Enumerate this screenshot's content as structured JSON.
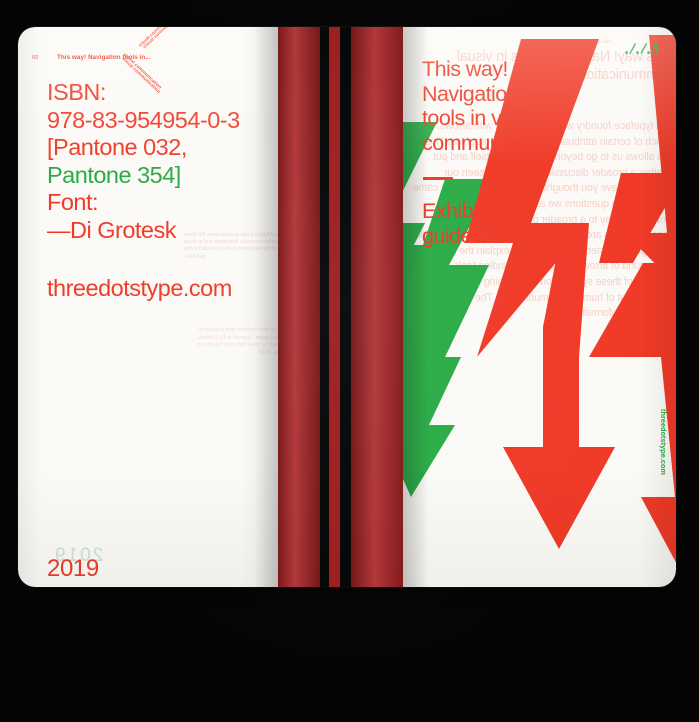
{
  "palette": {
    "red": "#f03a27",
    "green": "#2aab46",
    "spine_red": "#a81f22",
    "paper": "#fbfaf6",
    "backdrop": "#000000",
    "ink_black": "#101010"
  },
  "left_page": {
    "folio": "60",
    "running_title": "This way! Navigation tools in...",
    "chevron_microtype": "visual communication",
    "colophon_lines": [
      {
        "text": "ISBN:",
        "color": "red"
      },
      {
        "text": "978-83-954954-0-3",
        "color": "red"
      },
      {
        "text": "[Pantone 032,",
        "color": "red"
      },
      {
        "text": "Pantone 354]",
        "color": "green"
      },
      {
        "text": "Font:",
        "color": "red"
      },
      {
        "text": "—Di Grotesk",
        "color": "red"
      }
    ],
    "url": "threedotstype.com",
    "year": "2019",
    "ghost_year": "2019",
    "ghost_block": "The exhibition guide accompanies the show and gathers essays, interviews and a visual index of the navigation tools presented in the galleries.",
    "ghost_block2": "Printed in two Pantone spot colours on uncoated paper. Typeset in Di Grotesk. Published by three dots type foundry in Warsaw, 2019."
  },
  "right_page": {
    "headline_lines": [
      "This way!",
      "Navigation",
      "tools in visual",
      "communication"
    ],
    "subtitle_lines": [
      {
        "text": "Exhibition",
        "color": "red"
      },
      {
        "text": "guide",
        "color": "red"
      }
    ],
    "logo_mark": "threedots-logo-icon",
    "vertical_url": "threedotstype.com",
    "ghost_micro": "This way! Navigation tools in...",
    "ghost_headline": "This way! Navigation tools in visual communication",
    "ghost_body": "As a typeface foundry we are obsessed with arrows, as a branch of certain attributes of navigation graphics. This idea allows us to go beyond typography itself and put together a broader discussion. “Have you seen our signs?” or “Have you thought about where this form came from?” are the questions we asked ourselves when showing the way to a broader public. The answers to those questions are part of this exhibition about the world of navigation systems. The aim is to explain the historical background of arrows and other wayfinding tools, and the influence of these symbols on the shaping and development of human communication. The whole spectrum of information."
  },
  "graphics": {
    "arrows": [
      {
        "name": "green-zigzag-arrow",
        "color": "#2aab46"
      },
      {
        "name": "red-zigzag-arrow-center",
        "color": "#f03a27"
      },
      {
        "name": "red-zigzag-arrow-right",
        "color": "#f03a27"
      }
    ]
  },
  "spine": {
    "bands": [
      {
        "name": "spine-band-left",
        "color": "#a81f22"
      },
      {
        "name": "spine-gap-1",
        "color": "#060606"
      },
      {
        "name": "spine-band-center",
        "color": "#9d1d20"
      },
      {
        "name": "spine-gap-2",
        "color": "#050505"
      },
      {
        "name": "spine-band-right",
        "color": "#a81f22"
      }
    ]
  }
}
